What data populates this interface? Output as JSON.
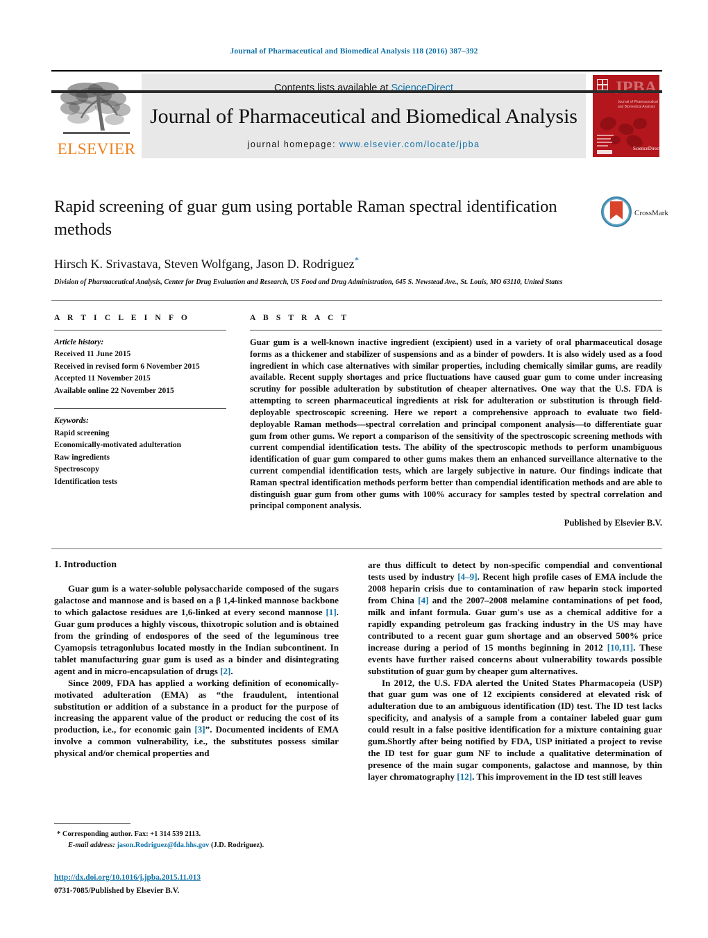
{
  "running_head": "Journal of Pharmaceutical and Biomedical Analysis 118 (2016) 387–392",
  "colors": {
    "link": "#1272a8",
    "elsevier_orange": "#f07f1a",
    "masthead_bg": "#e8e8e8",
    "cover_red": "#b3161c"
  },
  "masthead": {
    "publisher_logo_alt": "elsevier-tree-logo",
    "publisher_name": "ELSEVIER",
    "contents_prefix": "Contents lists available at ",
    "contents_link": "ScienceDirect",
    "journal_name": "Journal of Pharmaceutical and Biomedical Analysis",
    "homepage_prefix": "journal homepage:",
    "homepage_url": "www.elsevier.com/locate/jpba",
    "cover": {
      "title_abbr": "JPBA",
      "subtitle": "Journal of Pharmaceutical and Biomedical Analysis",
      "footer_brand": "ScienceDirect"
    }
  },
  "article": {
    "title": "Rapid screening of guar gum using portable Raman spectral identification methods",
    "authors": "Hirsch K. Srivastava, Steven Wolfgang, Jason D. Rodriguez",
    "corresponding_marker": "*",
    "affiliation": "Division of Pharmaceutical Analysis, Center for Drug Evaluation and Research, US Food and Drug Administration, 645 S. Newstead Ave., St. Louis, MO 63110, United States",
    "crossmark_label": "CrossMark"
  },
  "article_info": {
    "heading": "A R T I C L E   I N F O",
    "history_label": "Article history:",
    "history": [
      "Received 11 June 2015",
      "Received in revised form 6 November 2015",
      "Accepted 11 November 2015",
      "Available online 22 November 2015"
    ],
    "keywords_label": "Keywords:",
    "keywords": [
      "Rapid screening",
      "Economically-motivated adulteration",
      "Raw ingredients",
      "Spectroscopy",
      "Identification tests"
    ]
  },
  "abstract": {
    "heading": "A B S T R A C T",
    "text": "Guar gum is a well-known inactive ingredient (excipient) used in a variety of oral pharmaceutical dosage forms as a thickener and stabilizer of suspensions and as a binder of powders. It is also widely used as a food ingredient in which case alternatives with similar properties, including chemically similar gums, are readily available. Recent supply shortages and price fluctuations have caused guar gum to come under increasing scrutiny for possible adulteration by substitution of cheaper alternatives. One way that the U.S. FDA is attempting to screen pharmaceutical ingredients at risk for adulteration or substitution is through field-deployable spectroscopic screening. Here we report a comprehensive approach to evaluate two field-deployable Raman methods—spectral correlation and principal component analysis—to differentiate guar gum from other gums. We report a comparison of the sensitivity of the spectroscopic screening methods with current compendial identification tests. The ability of the spectroscopic methods to perform unambiguous identification of guar gum compared to other gums makes them an enhanced surveillance alternative to the current compendial identification tests, which are largely subjective in nature. Our findings indicate that Raman spectral identification methods perform better than compendial identification methods and are able to distinguish guar gum from other gums with 100% accuracy for samples tested by spectral correlation and principal component analysis.",
    "publisher_line": "Published by Elsevier B.V."
  },
  "body": {
    "section_heading": "1.  Introduction",
    "left_paragraphs": [
      {
        "parts": [
          {
            "t": "Guar gum is a water-soluble polysaccharide composed of the sugars galactose and mannose and is based on a β 1,4-linked mannose backbone to which galactose residues are 1,6-linked at every second mannose "
          },
          {
            "t": "[1]",
            "ref": true
          },
          {
            "t": ". Guar gum produces a highly viscous, thixotropic solution and is obtained from the grinding of endospores of the seed of the leguminous tree Cyamopsis tetragonlubus located mostly in the Indian subcontinent. In tablet manufacturing guar gum is used as a binder and disintegrating agent and in micro-encapsulation of drugs "
          },
          {
            "t": "[2]",
            "ref": true
          },
          {
            "t": "."
          }
        ]
      },
      {
        "parts": [
          {
            "t": "Since 2009, FDA has applied a working definition of economically-motivated adulteration (EMA) as “the fraudulent, intentional substitution or addition of a substance in a product for the purpose of increasing the apparent value of the product or reducing the cost of its production, i.e., for economic gain "
          },
          {
            "t": "[3]",
            "ref": true
          },
          {
            "t": "”. Documented incidents of EMA involve a common vulnerability, i.e., the substitutes possess similar physical and/or chemical properties and"
          }
        ]
      }
    ],
    "right_paragraphs": [
      {
        "no_indent": true,
        "parts": [
          {
            "t": "are thus difficult to detect by non-specific compendial and conventional tests used by industry "
          },
          {
            "t": "[4–9]",
            "ref": true
          },
          {
            "t": ". Recent high profile cases of EMA include the 2008 heparin crisis due to contamination of raw heparin stock imported from China "
          },
          {
            "t": "[4]",
            "ref": true
          },
          {
            "t": " and the 2007–2008 melamine contaminations of pet food, milk and infant formula. Guar gum's use as a chemical additive for a rapidly expanding petroleum gas fracking industry in the US may have contributed to a recent guar gum shortage and an observed 500% price increase during a period of 15 months beginning in 2012 "
          },
          {
            "t": "[10,11]",
            "ref": true
          },
          {
            "t": ". These events have further raised concerns about vulnerability towards possible substitution of guar gum by cheaper gum alternatives."
          }
        ]
      },
      {
        "parts": [
          {
            "t": "In 2012, the U.S. FDA alerted the United States Pharmacopeia (USP) that guar gum was one of 12 excipients considered at elevated risk of adulteration due to an ambiguous identification (ID) test. The ID test lacks specificity, and analysis of a sample from a container labeled guar gum could result in a false positive identification for a mixture containing guar gum.Shortly after being notified by FDA, USP initiated a project to revise the ID test for guar gum NF to include a qualitative determination of presence of the main sugar components, galactose and mannose, by thin layer chromatography "
          },
          {
            "t": "[12]",
            "ref": true
          },
          {
            "t": ". This improvement in the ID test still leaves"
          }
        ]
      }
    ]
  },
  "footer": {
    "corresponding_marker": "*",
    "corresponding_text": "Corresponding author. Fax: +1 314 539 2113.",
    "email_label": "E-mail address:",
    "email": "jason.Rodriguez@fda.hhs.gov",
    "email_owner": "(J.D. Rodriguez).",
    "doi_url": "http://dx.doi.org/10.1016/j.jpba.2015.11.013",
    "issn_line": "0731-7085/Published by Elsevier B.V."
  }
}
